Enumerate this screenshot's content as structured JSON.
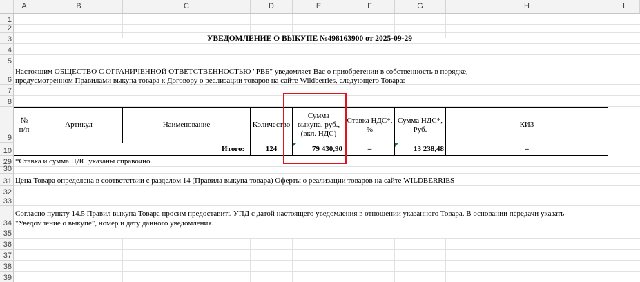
{
  "columns": [
    "A",
    "B",
    "C",
    "D",
    "E",
    "F",
    "G",
    "H",
    "I"
  ],
  "rows": [
    "1",
    "2",
    "3",
    "4",
    "5",
    "6",
    "7",
    "8",
    "9",
    "10",
    "29",
    "30",
    "31",
    "32",
    "33",
    "34",
    "35",
    "36",
    "37",
    "38",
    "39"
  ],
  "document": {
    "title": "УВЕДОМЛЕНИЕ О ВЫКУПЕ №498163900 от 2025-09-29",
    "intro_line1": "Настоящим ОБЩЕСТВО С ОГРАНИЧЕННОЙ ОТВЕТСТВЕННОСТЬЮ \"РВБ\" уведомляет Вас о приобретении в собственность в порядке,",
    "intro_line2": "предусмотренном Правилами выкупа товара к Договору о реализации товаров на сайте Wildberries, следующего Товара:",
    "table": {
      "headers": {
        "num_line1": "№",
        "num_line2": "п/п",
        "article": "Артикул",
        "name": "Наименование",
        "qty": "Количество",
        "sum_line1": "Сумма",
        "sum_line2": "выкупа, руб.,",
        "sum_line3": "(вкл. НДС)",
        "vat_rate_line1": "Ставка НДС*,",
        "vat_rate_line2": "%",
        "vat_sum_line1": "Сумма НДС*,",
        "vat_sum_line2": "Руб.",
        "kiz": "КИЗ"
      },
      "total": {
        "label": "Итого:",
        "qty": "124",
        "sum": "79 430,90",
        "vat_rate": "–",
        "vat_sum": "13 238,48",
        "kiz": "–"
      }
    },
    "note_vat": "*Ставка и сумма НДС указаны справочно.",
    "price_note": "Цена Товара определена в соответствии с разделом 14 (Правила выкупа товара) Оферты о реализации товаров на сайте WILDBERRIES",
    "request_line1": "Согласно пункту 14.5 Правил выкупа Товара просим предоставить УПД с датой настоящего уведомления в отношении указанного Товара. В основании передачи указать",
    "request_line2": "\"Уведомление о выкупе\", номер и дату данного уведомления."
  },
  "highlight_color": "#e3131b"
}
